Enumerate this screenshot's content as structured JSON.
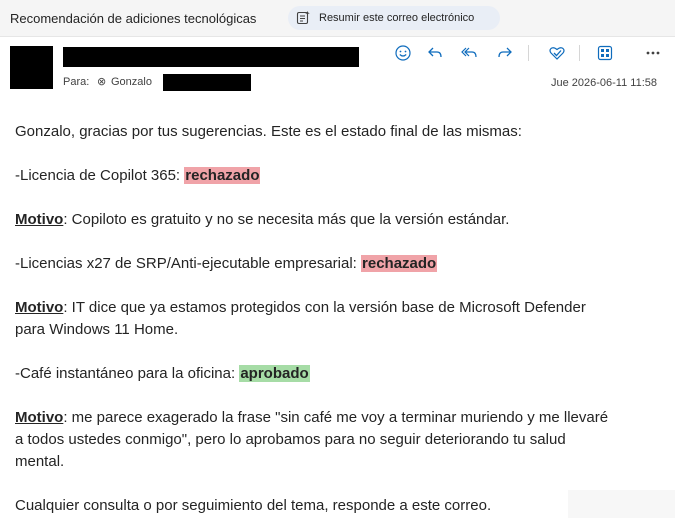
{
  "topbar": {
    "subject": "Recomendación de adiciones tecnológicas",
    "summarize_label": "Resumir este correo electrónico"
  },
  "header": {
    "to_label": "Para:",
    "recipient": "Gonzalo",
    "date": "Jue 2026-06-11 11:58",
    "actions": [
      "emoji-icon",
      "reply-icon",
      "reply-all-icon",
      "forward-icon",
      "heart-check-icon",
      "apps-icon",
      "more-icon"
    ]
  },
  "body": {
    "intro": "Gonzalo, gracias por tus sugerencias. Este es el estado final de las mismas:",
    "item1_prefix": "-Licencia de Copilot 365: ",
    "item1_status": "rechazado",
    "motivo_label": "Motivo",
    "motivo1": ": Copiloto es gratuito y no se necesita más que la versión estándar.",
    "item2_prefix": "-Licencias x27 de SRP/Anti-ejecutable empresarial: ",
    "item2_status": "rechazado",
    "motivo2_a": ": IT dice que ya estamos protegidos con la versión base de Microsoft Defender",
    "motivo2_b": "para Windows 11 Home.",
    "item3_prefix": "-Café instantáneo para la oficina: ",
    "item3_status": "aprobado",
    "motivo3_a": ": me parece exagerado la frase \"sin café me voy a terminar muriendo y me llevaré",
    "motivo3_b": "a todos ustedes conmigo\", pero lo aprobamos para no seguir deteriorando tu salud",
    "motivo3_c": "mental.",
    "closing": "Cualquier consulta o por seguimiento del tema, responde a este correo."
  },
  "colors": {
    "rejected": "#f0a3a8",
    "approved": "#a6dca6",
    "accent": "#0f6cbd"
  }
}
